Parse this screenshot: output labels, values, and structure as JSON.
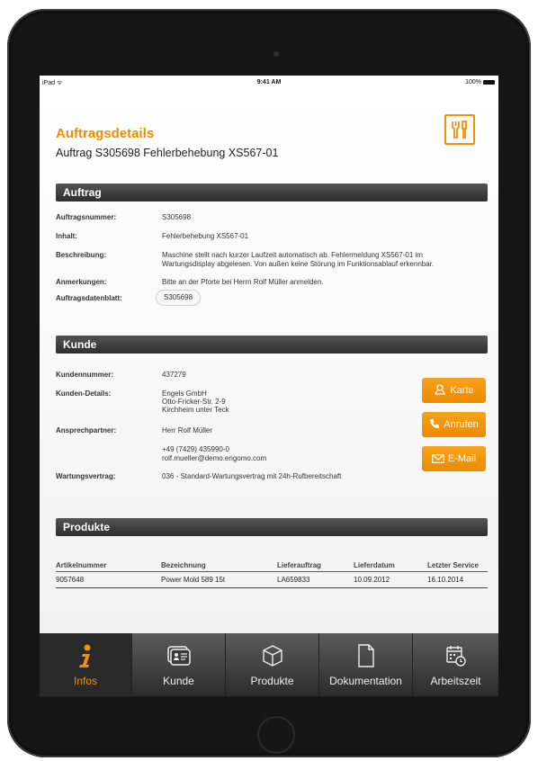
{
  "statusbar": {
    "carrier": "iPad",
    "time": "9:41 AM",
    "battery": "100%"
  },
  "header": {
    "title": "Auftragsdetails",
    "subtitle": "Auftrag S305698 Fehlerbehebung XS567-01"
  },
  "colors": {
    "accent": "#f39200",
    "bar_dark": "#3a3a3a"
  },
  "auftrag": {
    "heading": "Auftrag",
    "rows": [
      {
        "label": "Auftragsnummer:",
        "value": "S305698"
      },
      {
        "label": "Inhalt:",
        "value": "Fehlerbehebung XS567-01"
      },
      {
        "label": "Beschreibung:",
        "value": "Maschine stellt nach kurzer Laufzeit automatisch ab. Fehlermeldung XS567-01 im",
        "value2": "Wartungsdisplay abgelesen. Von außen keine Störung im Funktionsablauf erkennbar."
      },
      {
        "label": "Anmerkungen:",
        "value": "Bitte an der Pforte bei Herrn Rolf Müller anmelden."
      },
      {
        "label": "Auftragsdatenblatt:",
        "value": "S305698"
      }
    ]
  },
  "kunde": {
    "heading": "Kunde",
    "nummer_label": "Kundennummer:",
    "nummer": "437279",
    "details_label": "Kunden-Details:",
    "details_line1": "Engels GmbH",
    "details_line2": "Otto-Fricker-Str. 2-9",
    "details_line3": "Kirchheim unter Teck",
    "partner_label": "Ansprechpartner:",
    "partner_name": "Herr Rolf Müller",
    "partner_phone": "+49 (7429) 435990-0",
    "partner_email": "rolf.mueller@demo.engomo.com",
    "vertrag_label": "Wartungsvertrag:",
    "vertrag": "036 - Standard-Wartungsvertrag mit 24h-Rufbereitschaft",
    "buttons": {
      "karte": "Karte",
      "anrufen": "Anrufen",
      "email": "E-Mail"
    }
  },
  "produkte": {
    "heading": "Produkte",
    "columns": [
      "Artikelnummer",
      "Bezeichnung",
      "Lieferauftrag",
      "Lieferdatum",
      "Letzter Service"
    ],
    "rows": [
      [
        "9057648",
        "Power Mold 589 15t",
        "LA659833",
        "10.09.2012",
        "16.10.2014"
      ]
    ]
  },
  "tabs": [
    {
      "label": "Infos",
      "icon": "info-icon",
      "active": true
    },
    {
      "label": "Kunde",
      "icon": "contact-card-icon",
      "active": false
    },
    {
      "label": "Produkte",
      "icon": "box-icon",
      "active": false
    },
    {
      "label": "Dokumentation",
      "icon": "document-icon",
      "active": false
    },
    {
      "label": "Arbeitszeit",
      "icon": "calendar-clock-icon",
      "active": false
    }
  ]
}
